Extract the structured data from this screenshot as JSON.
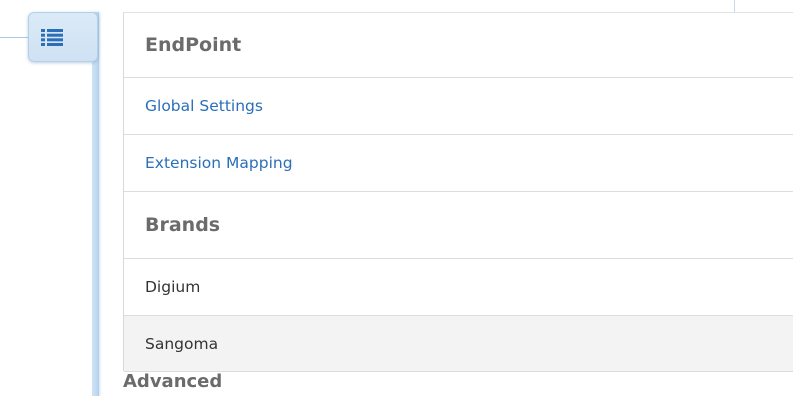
{
  "sidebar_toggle": {
    "icon": "list-icon",
    "color": "#2a6fb8"
  },
  "menu": {
    "sections": [
      {
        "header": "EndPoint",
        "items": [
          "Global Settings",
          "Extension Mapping"
        ]
      },
      {
        "header": "Brands",
        "items": [
          "Digium",
          "Sangoma"
        ],
        "selected": "Sangoma"
      }
    ],
    "next_header": "Advanced"
  },
  "colors": {
    "link": "#2a6fb8",
    "header": "#6b6b6b",
    "selected_row_bg": "#f3f3f3",
    "rail": "#cfe3f5"
  }
}
